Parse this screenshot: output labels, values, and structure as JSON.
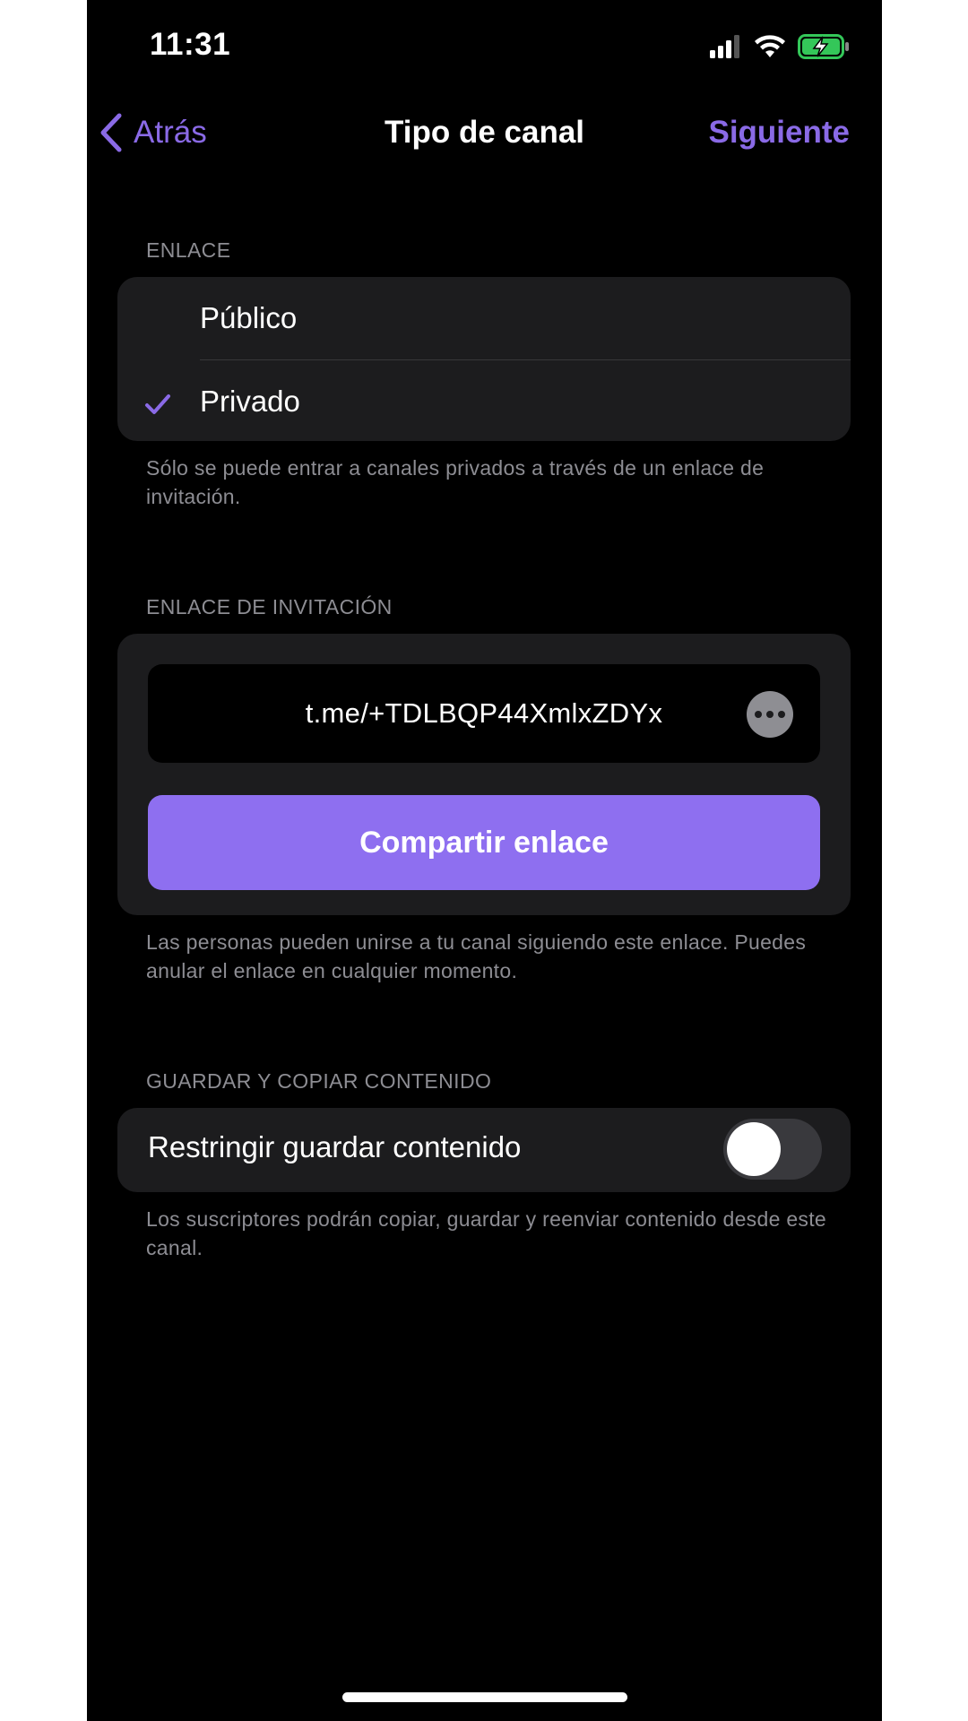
{
  "status_bar": {
    "time": "11:31",
    "signal_icon": "cellular-signal-icon",
    "wifi_icon": "wifi-icon",
    "battery_icon": "battery-charging-icon",
    "battery_color": "#34c759"
  },
  "nav": {
    "back_label": "Atrás",
    "title": "Tipo de canal",
    "next_label": "Siguiente"
  },
  "accent_color": "#8a6ae6",
  "link_section": {
    "header": "ENLACE",
    "options": [
      {
        "label": "Público",
        "selected": false
      },
      {
        "label": "Privado",
        "selected": true
      }
    ],
    "footer": "Sólo se puede entrar a canales privados a través de un enlace de invitación."
  },
  "invite_section": {
    "header": "ENLACE DE INVITACIÓN",
    "link": "t.me/+TDLBQP44XmlxZDYx",
    "more_icon": "ellipsis-icon",
    "share_label": "Compartir enlace",
    "footer": "Las personas pueden unirse a tu canal siguiendo este enlace. Puedes anular el enlace en cualquier momento."
  },
  "content_section": {
    "header": "GUARDAR Y COPIAR CONTENIDO",
    "toggle_label": "Restringir guardar contenido",
    "toggle_on": false,
    "footer": "Los suscriptores podrán copiar, guardar y reenviar contenido desde este canal."
  }
}
